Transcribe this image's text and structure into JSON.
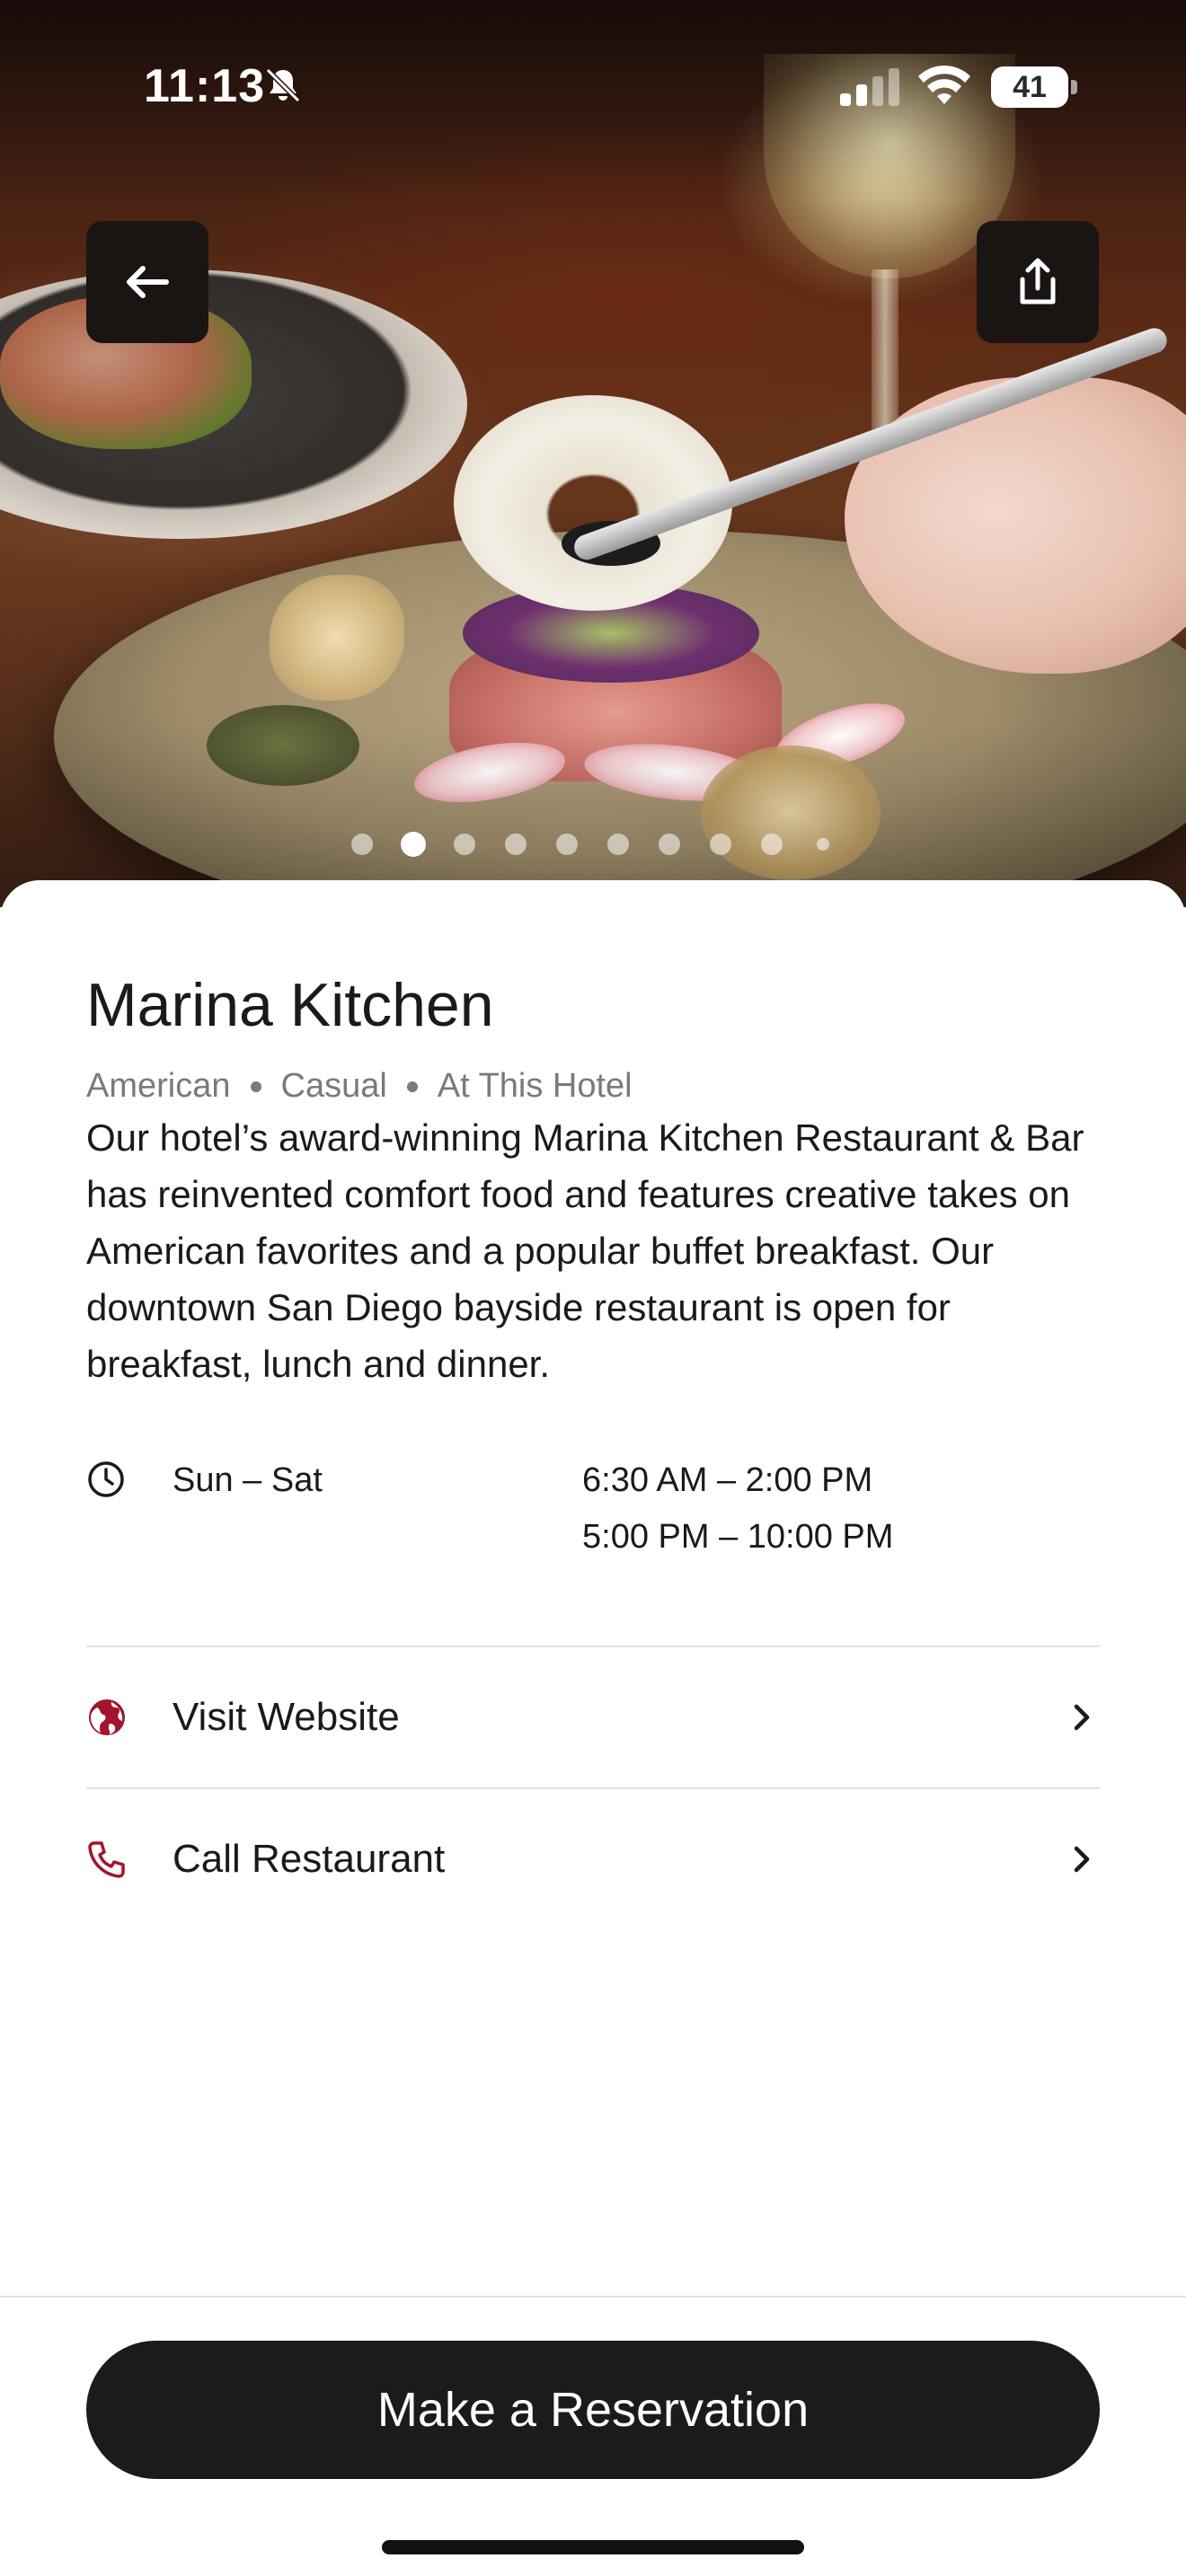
{
  "status_bar": {
    "time": "11:13",
    "battery_level": "41",
    "battery_fraction": 0.41
  },
  "hero": {
    "carousel": {
      "total": 10,
      "active_index": 1
    },
    "back_icon": "arrow-left-icon",
    "share_icon": "share-icon"
  },
  "restaurant": {
    "name": "Marina Kitchen",
    "tags": [
      "American",
      "Casual",
      "At This Hotel"
    ],
    "description": "Our hotel’s award-winning Marina Kitchen Restaurant & Bar has reinvented comfort food and features creative takes on American favorites and a popular buffet breakfast. Our downtown San Diego bayside restaurant is open for breakfast, lunch and dinner."
  },
  "hours": {
    "days": "Sun – Sat",
    "slots": [
      "6:30 AM – 2:00 PM",
      "5:00 PM – 10:00 PM"
    ]
  },
  "links": [
    {
      "label": "Visit Website",
      "icon": "globe-icon"
    },
    {
      "label": "Call Restaurant",
      "icon": "phone-icon"
    }
  ],
  "cta": {
    "label": "Make a Reservation"
  },
  "colors": {
    "accent": "#a3142e",
    "cta_bg": "#1b1b1b",
    "muted_text": "#7a7a7a",
    "divider": "#e2e2e2"
  }
}
